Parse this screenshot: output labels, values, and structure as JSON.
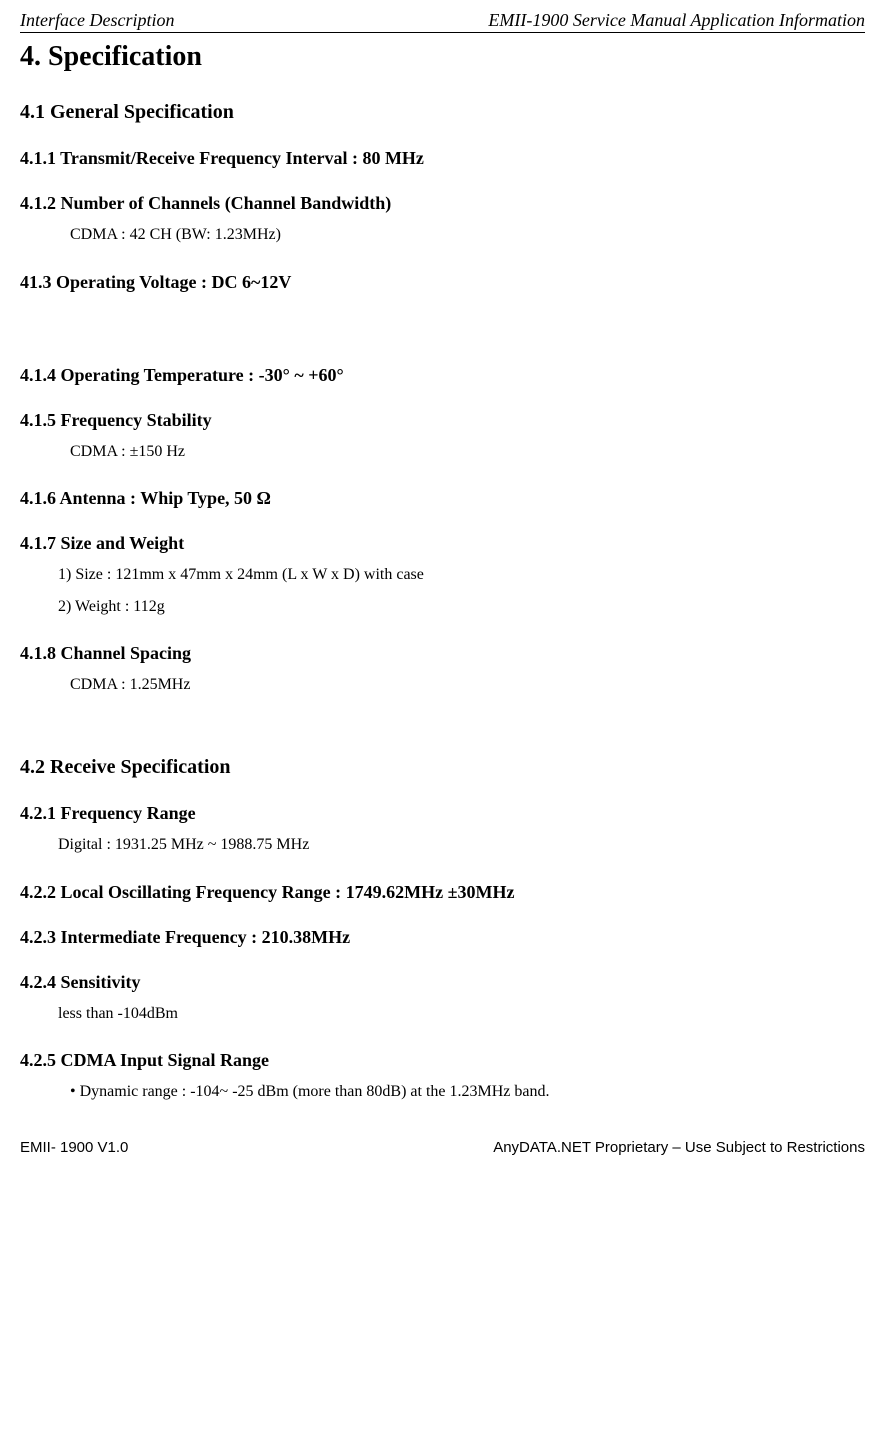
{
  "header": {
    "left": "Interface Description",
    "right": "EMII-1900 Service Manual Application Information"
  },
  "title": "4. Specification",
  "s41": {
    "heading": "4.1 General Specification",
    "s411": "4.1.1 Transmit/Receive Frequency Interval : 80 MHz",
    "s412": {
      "heading": "4.1.2 Number of Channels (Channel Bandwidth)",
      "body": "CDMA : 42 CH (BW: 1.23MHz)"
    },
    "s413": "41.3 Operating Voltage : DC 6~12V",
    "s414": "4.1.4 Operating Temperature : -30° ~ +60°",
    "s415": {
      "heading": "4.1.5 Frequency Stability",
      "body": "CDMA :  ±150 Hz"
    },
    "s416": "4.1.6 Antenna : Whip Type, 50 Ω",
    "s417": {
      "heading": "4.1.7 Size and Weight",
      "l1": "1) Size : 121mm x 47mm x 24mm (L x W x D) with case",
      "l2": "2) Weight : 112g"
    },
    "s418": {
      "heading": "4.1.8 Channel Spacing",
      "body": "CDMA : 1.25MHz"
    }
  },
  "s42": {
    "heading": "4.2 Receive Specification",
    "s421": {
      "heading": "4.2.1 Frequency Range",
      "body": "Digital : 1931.25 MHz ~ 1988.75 MHz"
    },
    "s422": "4.2.2 Local Oscillating Frequency Range : 1749.62MHz  ±30MHz",
    "s423": "4.2.3 Intermediate Frequency : 210.38MHz",
    "s424": {
      "heading": "4.2.4 Sensitivity",
      "body": "less than   -104dBm"
    },
    "s425": {
      "heading": "4.2.5 CDMA Input Signal Range",
      "body": "• Dynamic range : -104~ -25 dBm (more than   80dB) at the 1.23MHz band."
    }
  },
  "footer": {
    "left": "EMII- 1900 V1.0",
    "right": "AnyDATA.NET Proprietary –  Use Subject to Restrictions"
  }
}
